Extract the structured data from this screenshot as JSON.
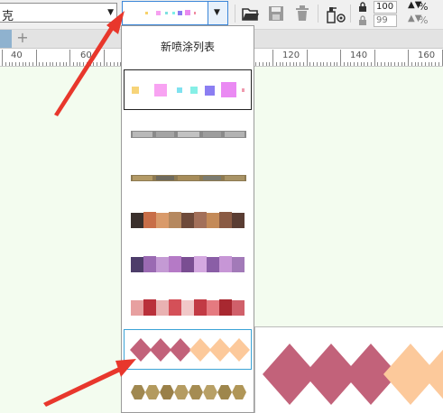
{
  "toolbar": {
    "font_name": "克",
    "spray_dropdown_icon": "chevron-down-icon",
    "icons": [
      "open-folder-icon",
      "save-icon",
      "trash-icon",
      "spray-bottle-icon",
      "settings-icon"
    ],
    "spin1_value": "100",
    "spin2_value": "99",
    "percent_label": "%"
  },
  "document": {
    "tab_add_label": "+"
  },
  "ruler": {
    "labels": [
      "40",
      "60",
      "120",
      "140",
      "160"
    ]
  },
  "dropdown": {
    "new_list_label": "新喷涂列表",
    "items": [
      {
        "name": "confetti-squares",
        "state": "selected"
      },
      {
        "name": "gray-stones",
        "state": "normal"
      },
      {
        "name": "brown-stones",
        "state": "normal"
      },
      {
        "name": "brown-tiles",
        "state": "normal"
      },
      {
        "name": "purple-tiles",
        "state": "normal"
      },
      {
        "name": "red-tiles",
        "state": "normal"
      },
      {
        "name": "pink-peach-diamonds",
        "state": "hover"
      },
      {
        "name": "gold-hexagons",
        "state": "normal"
      }
    ]
  },
  "colors": {
    "accent": "#3b86d8",
    "arrow": "#e8372c",
    "diamond_pink": "#c2627a",
    "diamond_peach": "#fcc99b",
    "canvas": "#f3fcef"
  }
}
